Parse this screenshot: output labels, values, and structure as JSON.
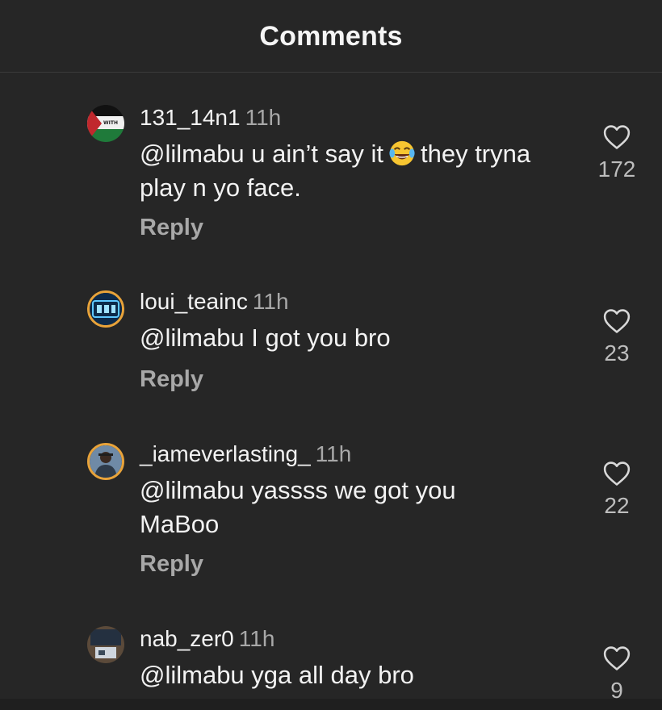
{
  "header": {
    "title": "Comments"
  },
  "comments": [
    {
      "username": "131_14n1",
      "time": "11h",
      "text_before": "@lilmabu u ain’t say it",
      "emoji": "face-with-tears-of-joy",
      "text_after": "they tryna play n yo face.",
      "reply": "Reply",
      "likes": "172",
      "avatar_text": "WITH"
    },
    {
      "username": "loui_teainc",
      "time": "11h",
      "text": "@lilmabu I got you bro",
      "reply": "Reply",
      "likes": "23"
    },
    {
      "username": "_iameverlasting_",
      "time": "11h",
      "text": "@lilmabu yassss we got you MaBoo",
      "reply": "Reply",
      "likes": "22"
    },
    {
      "username": "nab_zer0",
      "time": "11h",
      "text": "@lilmabu yga all day bro",
      "likes": "9"
    }
  ],
  "colors": {
    "background": "#262626",
    "story_ring": "#e8a33a",
    "muted_text": "#a8a8a8"
  }
}
